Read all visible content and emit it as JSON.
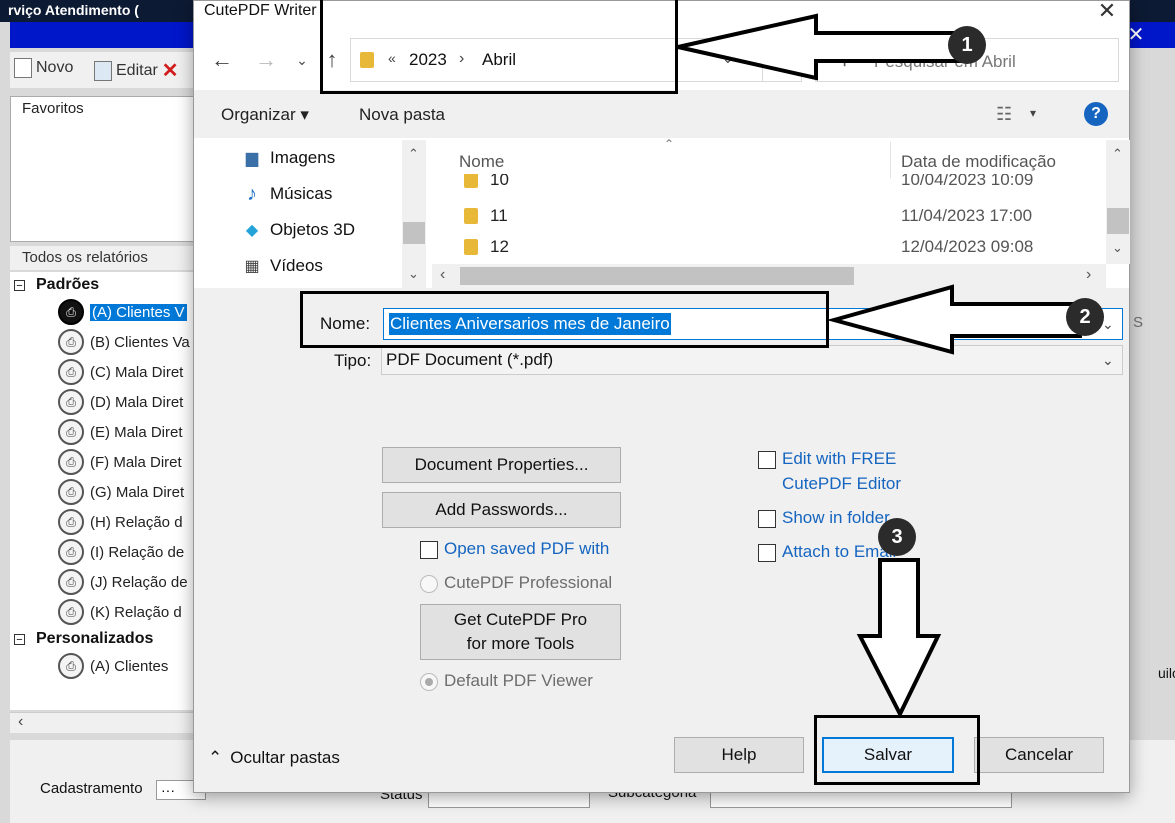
{
  "background_app": {
    "title_fragment": "rviço Atendimento (",
    "toolbar": {
      "new_label": "Novo",
      "edit_label": "Editar"
    },
    "favorites_label": "Favoritos",
    "all_reports_label": "Todos os relatórios",
    "tree": {
      "standard_group": "Padrões",
      "standard_items": [
        "(A) Clientes V",
        "(B) Clientes Va",
        "(C) Mala Diret",
        "(D) Mala Diret",
        "(E) Mala Diret",
        "(F) Mala Diret",
        "(G) Mala Diret",
        "(H) Relação d",
        "(I) Relação de",
        "(J) Relação de",
        "(K) Relação d"
      ],
      "custom_group": "Personalizados",
      "custom_items": [
        "(A) Clientes"
      ]
    },
    "bottom": {
      "cadastro_label": "Cadastramento",
      "cadastro_value": "···",
      "status_label": "Status",
      "subcategory_label": "Subcategoria"
    },
    "right_fragment": "uilo"
  },
  "dialog": {
    "title": "CutePDF Writer",
    "close_glyph": "✕",
    "nav": {
      "back": "←",
      "forward": "→",
      "recent": "⌄",
      "up": "↑"
    },
    "address": {
      "separator": "«",
      "crumbs": [
        "2023",
        "Abril"
      ],
      "chevron": "›",
      "dropdown": "⌄",
      "refresh": "↻"
    },
    "search": {
      "placeholder": "Pesquisar em Abril",
      "icon": "⚲"
    },
    "commands": {
      "organize": "Organizar ▾",
      "new_folder": "Nova pasta",
      "view_icon": "☷",
      "view_dropdown": "▾",
      "help": "?"
    },
    "nav_pane": [
      {
        "label": "Imagens",
        "icon": "▆"
      },
      {
        "label": "Músicas",
        "icon": "♪"
      },
      {
        "label": "Objetos 3D",
        "icon": "◆"
      },
      {
        "label": "Vídeos",
        "icon": "▦"
      }
    ],
    "scroll": {
      "up": "⌃",
      "down": "⌄",
      "left": "‹",
      "right": "›"
    },
    "file_list": {
      "sort_indicator": "⌃",
      "col_name": "Nome",
      "col_date": "Data de modificação",
      "rows": [
        {
          "name": "10",
          "date": "10/04/2023 10:09"
        },
        {
          "name": "11",
          "date": "11/04/2023 17:00"
        },
        {
          "name": "12",
          "date": "12/04/2023 09:08"
        }
      ]
    },
    "filename": {
      "label": "Nome:",
      "value": "Clientes Aniversarios mes de Janeiro",
      "dropdown": "⌄",
      "right_fragment": "S"
    },
    "filetype": {
      "label": "Tipo:",
      "value": "PDF Document (*.pdf)",
      "dropdown": "⌄"
    },
    "options": {
      "document_properties": "Document Properties...",
      "add_passwords": "Add Passwords...",
      "open_saved_pdf": "Open saved PDF with",
      "cutepdf_professional": "CutePDF Professional",
      "get_pro_line1": "Get CutePDF Pro",
      "get_pro_line2": "for more Tools",
      "default_viewer": "Default PDF Viewer",
      "edit_free_line1": "Edit with FREE",
      "edit_free_line2": "CutePDF Editor",
      "show_in_folder": "Show in folder",
      "attach_email": "Attach to Email"
    },
    "footer": {
      "hide_folders": "Ocultar pastas",
      "hide_icon": "⌃",
      "help": "Help",
      "save": "Salvar",
      "cancel": "Cancelar"
    }
  },
  "annotations": {
    "step1": "1",
    "step2": "2",
    "step3": "3"
  }
}
